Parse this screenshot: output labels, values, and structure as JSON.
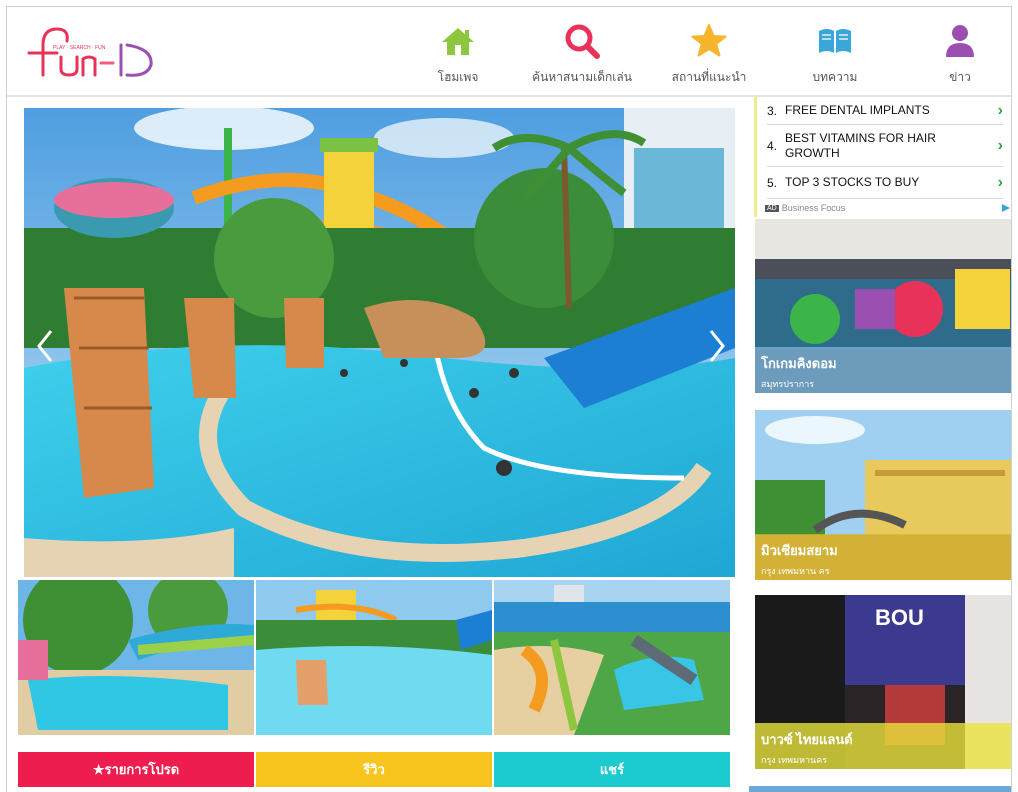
{
  "header": {
    "logo_text": "fun-D",
    "logo_tagline": "PLAY · SEARCH · FUN",
    "nav": [
      {
        "label": "โฮมเพจ",
        "icon": "home-icon",
        "color": "#8dc63f"
      },
      {
        "label": "ค้นหาสนามเด็กเล่น",
        "icon": "search-icon",
        "color": "#e8325a"
      },
      {
        "label": "สถานที่แนะนำ",
        "icon": "star-icon",
        "color": "#f7b52c"
      },
      {
        "label": "บทความ",
        "icon": "book-icon",
        "color": "#3ba7d8"
      },
      {
        "label": "ข่าว",
        "icon": "person-icon",
        "color": "#9b4fb0"
      }
    ]
  },
  "ad": {
    "items": [
      {
        "num": "3.",
        "text": "FREE DENTAL IMPLANTS"
      },
      {
        "num": "4.",
        "text": "BEST VITAMINS FOR HAIR GROWTH"
      },
      {
        "num": "5.",
        "text": "TOP 3 STOCKS TO BUY"
      }
    ],
    "sponsor": "Business Focus",
    "badge": "AD"
  },
  "side_cards": [
    {
      "title": "โกเกมคิงดอม",
      "subtitle": "สมุทรปราการ"
    },
    {
      "title": "มิวเซียมสยาม",
      "subtitle": "กรุง เทพมหาน คร"
    },
    {
      "title": "บาวซ์ ไทยแลนด์",
      "subtitle": "กรุง เทพมหานคร"
    }
  ],
  "tabs": [
    {
      "label": "★รายการโปรด",
      "color": "#ee1c4f"
    },
    {
      "label": "รีวิว",
      "color": "#f8c41e"
    },
    {
      "label": "แชร์",
      "color": "#1ccbd0"
    }
  ]
}
